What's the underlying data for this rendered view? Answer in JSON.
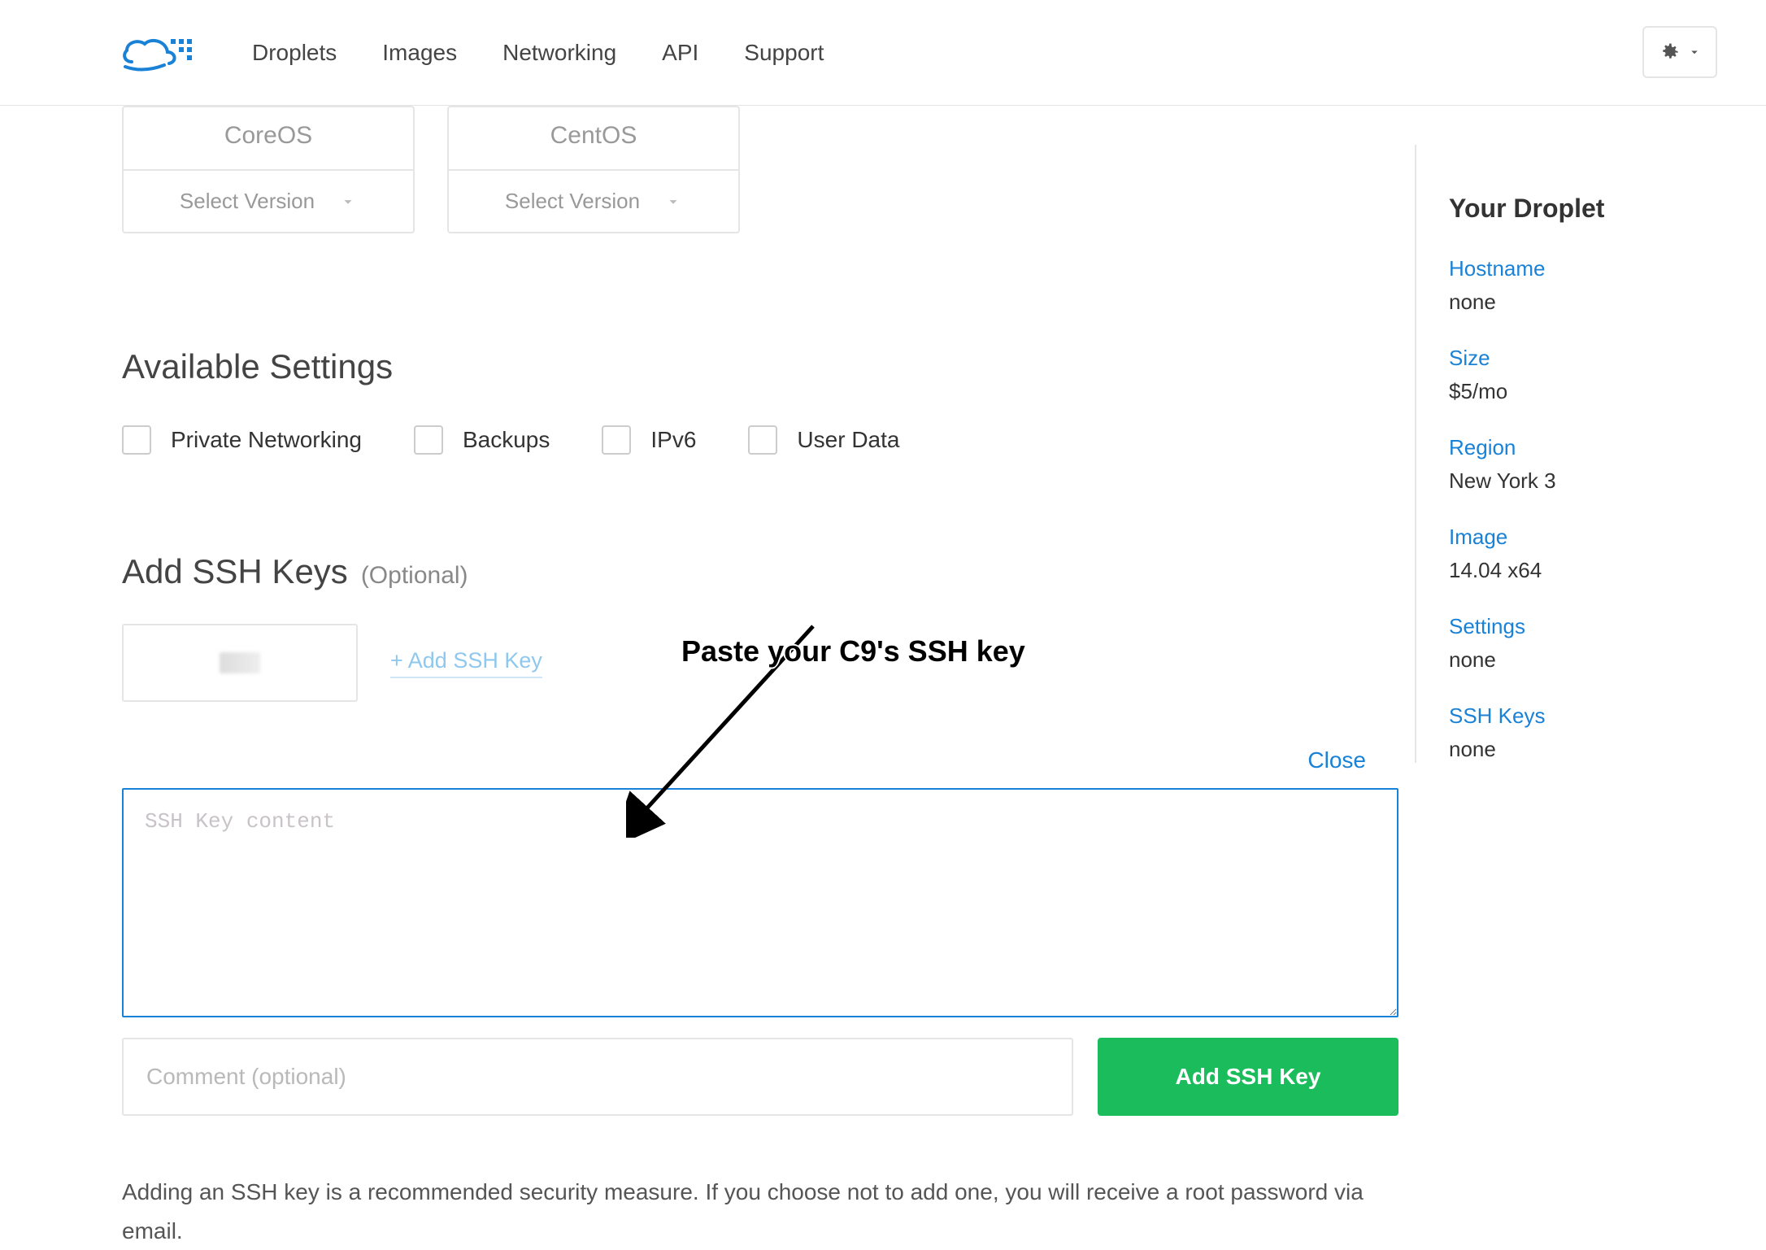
{
  "nav": {
    "items": [
      "Droplets",
      "Images",
      "Networking",
      "API",
      "Support"
    ]
  },
  "os": {
    "cards": [
      {
        "name": "CoreOS",
        "select": "Select Version"
      },
      {
        "name": "CentOS",
        "select": "Select Version"
      }
    ]
  },
  "settings": {
    "heading": "Available Settings",
    "options": [
      "Private Networking",
      "Backups",
      "IPv6",
      "User Data"
    ]
  },
  "ssh": {
    "heading": "Add SSH Keys",
    "optional": "(Optional)",
    "add_link": "+ Add SSH Key",
    "close": "Close",
    "placeholder": "SSH Key content",
    "comment_placeholder": "Comment (optional)",
    "add_button": "Add SSH Key",
    "hint": "Adding an SSH key is a recommended security measure. If you choose not to add one, you will receive a root password via email."
  },
  "sidebar": {
    "heading": "Your Droplet",
    "items": [
      {
        "label": "Hostname",
        "value": "none"
      },
      {
        "label": "Size",
        "value": "$5/mo"
      },
      {
        "label": "Region",
        "value": "New York 3"
      },
      {
        "label": "Image",
        "value": "14.04 x64"
      },
      {
        "label": "Settings",
        "value": "none"
      },
      {
        "label": "SSH Keys",
        "value": "none"
      }
    ]
  },
  "annotation": {
    "text": "Paste your C9's SSH key"
  }
}
